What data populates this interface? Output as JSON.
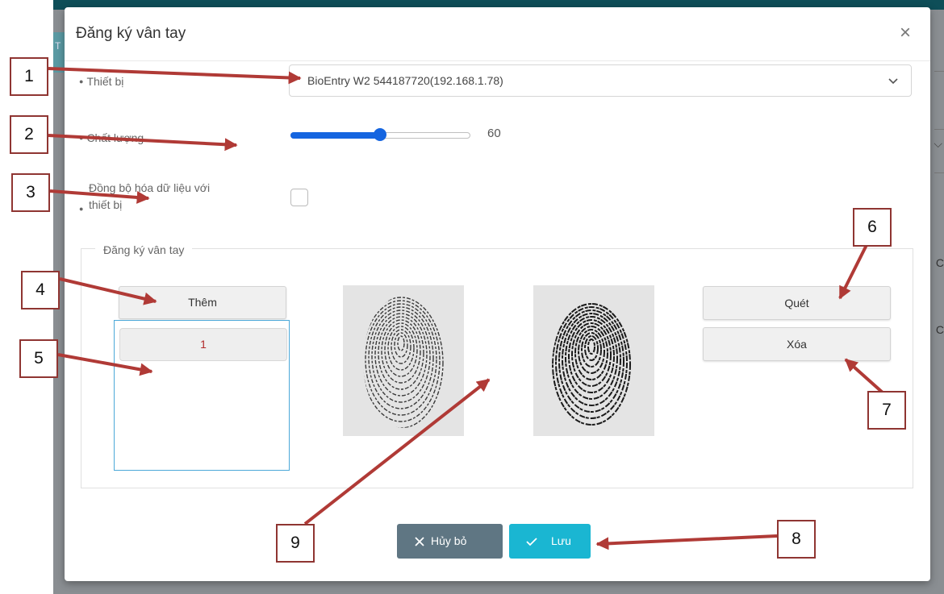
{
  "background": {
    "tab_letter": "T",
    "right_chevron": "⌵",
    "right_letter_1": "C",
    "right_letter_2": "C"
  },
  "modal": {
    "title": "Đăng ký vân tay",
    "close_symbol": "×",
    "device_label": "Thiết bị",
    "device_value": "BioEntry W2 544187720(192.168.1.78)",
    "quality_label": "Chất lượng",
    "quality_value": "60",
    "quality_fraction": 0.5,
    "sync_label_line1": "Đồng bộ hóa dữ liệu với",
    "sync_label_line2": "thiết bị",
    "sync_checked": false,
    "fieldset_legend": "Đăng ký vân tay",
    "add_button": "Thêm",
    "fingerprint_list": [
      "1"
    ],
    "scan_button": "Quét",
    "delete_button": "Xóa",
    "cancel_button": "Hủy bỏ",
    "save_button": "Lưu"
  },
  "callouts": [
    "1",
    "2",
    "3",
    "4",
    "5",
    "6",
    "7",
    "8",
    "9"
  ],
  "colors": {
    "slider": "#1565e0",
    "cancel_bg": "#5f7683",
    "save_bg": "#1ab6d2",
    "list_text": "#b22a2a",
    "callout_arrow": "#b03a36",
    "callout_border": "#8f3532"
  }
}
